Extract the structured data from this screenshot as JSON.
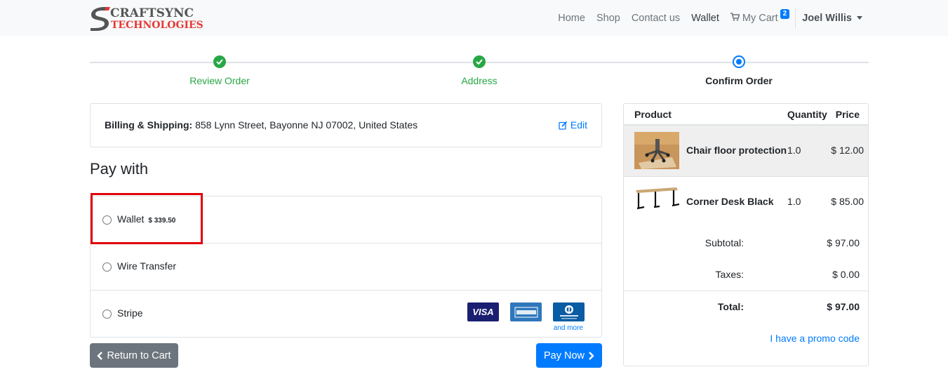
{
  "brand": {
    "line1": "CRAFTSYNC",
    "line2": "TECHNOLOGIES",
    "initial": "S"
  },
  "nav": {
    "home": "Home",
    "shop": "Shop",
    "contact": "Contact us",
    "wallet": "Wallet",
    "cart": "My Cart",
    "cart_count": "2",
    "user": "Joel Willis"
  },
  "steps": [
    {
      "label": "Review Order",
      "state": "done"
    },
    {
      "label": "Address",
      "state": "done"
    },
    {
      "label": "Confirm Order",
      "state": "current"
    }
  ],
  "address": {
    "label": "Billing & Shipping:",
    "value": " 858 Lynn Street, Bayonne NJ 07002, United States",
    "edit": "Edit"
  },
  "payment": {
    "title": "Pay with",
    "methods": [
      {
        "label": "Wallet",
        "amount": "$ 339.50"
      },
      {
        "label": "Wire Transfer"
      },
      {
        "label": "Stripe"
      }
    ],
    "card_logos": [
      "VISA",
      "AMERICAN EXPRESS",
      "Diners Club INTERNATIONAL"
    ],
    "and_more": "and more"
  },
  "buttons": {
    "return": "Return to Cart",
    "pay": "Pay Now"
  },
  "summary": {
    "headers": {
      "product": "Product",
      "quantity": "Quantity",
      "price": "Price"
    },
    "items": [
      {
        "name": "Chair floor protection",
        "qty": "1.0",
        "price": "$ 12.00"
      },
      {
        "name": "Corner Desk Black",
        "qty": "1.0",
        "price": "$ 85.00"
      }
    ],
    "subtotal_label": "Subtotal:",
    "subtotal": "$ 97.00",
    "taxes_label": "Taxes:",
    "taxes": "$ 0.00",
    "total_label": "Total:",
    "total": "$ 97.00",
    "promo": "I have a promo code"
  },
  "colors": {
    "primary": "#007bff",
    "success": "#28a745",
    "secondary": "#6c757d",
    "highlight": "#e0000b",
    "brand_red": "#e53935"
  }
}
